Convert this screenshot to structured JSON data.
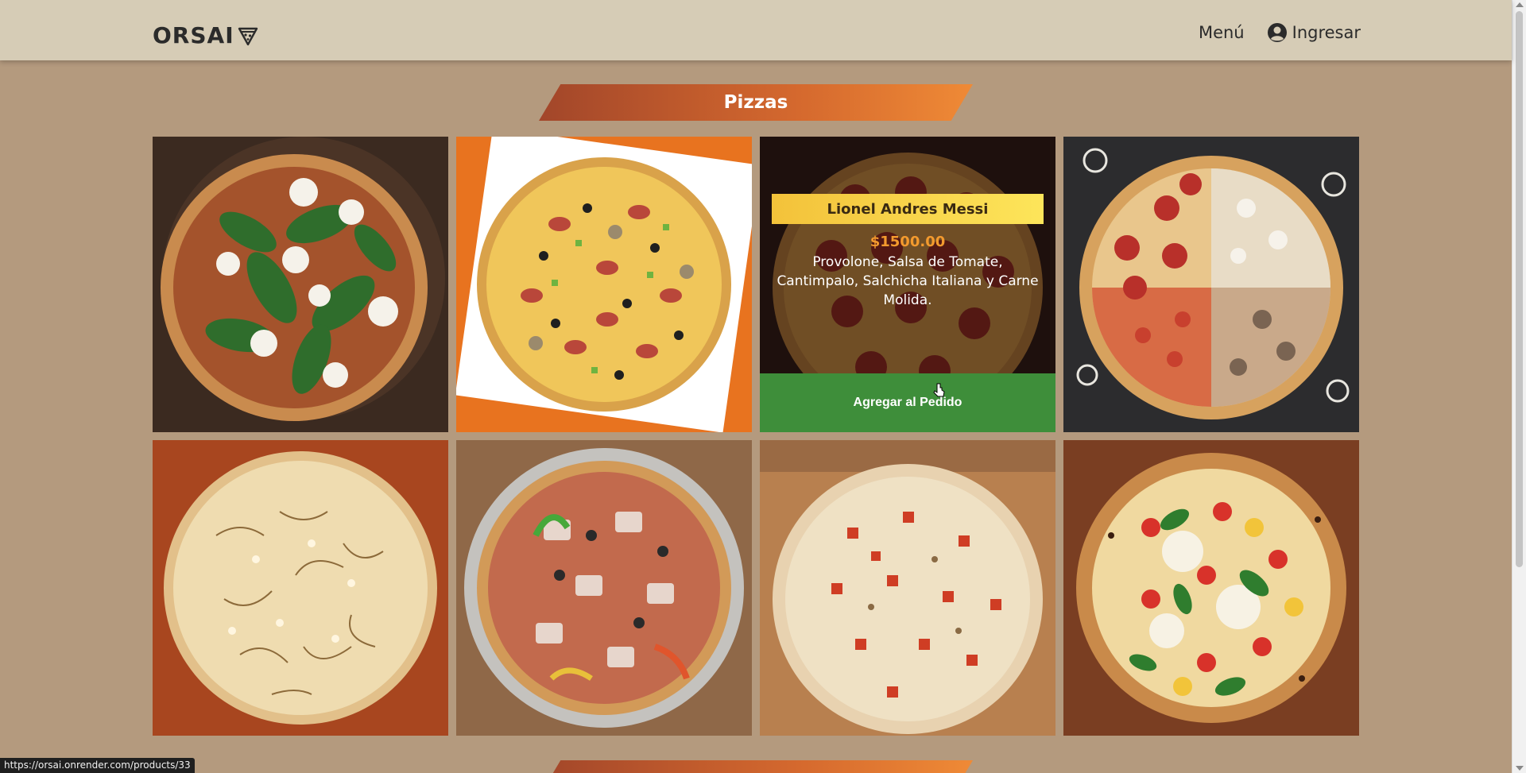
{
  "header": {
    "brand": "ORSAI",
    "menu_label": "Menú",
    "login_label": "Ingresar"
  },
  "section": {
    "title": "Pizzas"
  },
  "products": [
    {
      "kind": "spinach-burrata"
    },
    {
      "kind": "sausage-olive"
    },
    {
      "kind": "pepperoni",
      "name": "Lionel Andres Messi",
      "price": "$1500.00",
      "description": "Provolone, Salsa de Tomate, Cantimpalo, Salchicha Italiana y Carne Molida.",
      "button": "Agregar al Pedido"
    },
    {
      "kind": "half-and-half"
    },
    {
      "kind": "fugazzeta"
    },
    {
      "kind": "meat-peppers"
    },
    {
      "kind": "chopped-tomato"
    },
    {
      "kind": "margherita-cherry"
    }
  ],
  "status_bar": {
    "url": "https://orsai.onrender.com/products/33"
  },
  "colors": {
    "background": "#b49a7e",
    "navbar": "#d6ccb6",
    "banner_start": "#a2462a",
    "banner_end": "#ef8a36",
    "name_box": "#fde55a",
    "price": "#f39a2e",
    "add_button": "#3e8e3a"
  }
}
